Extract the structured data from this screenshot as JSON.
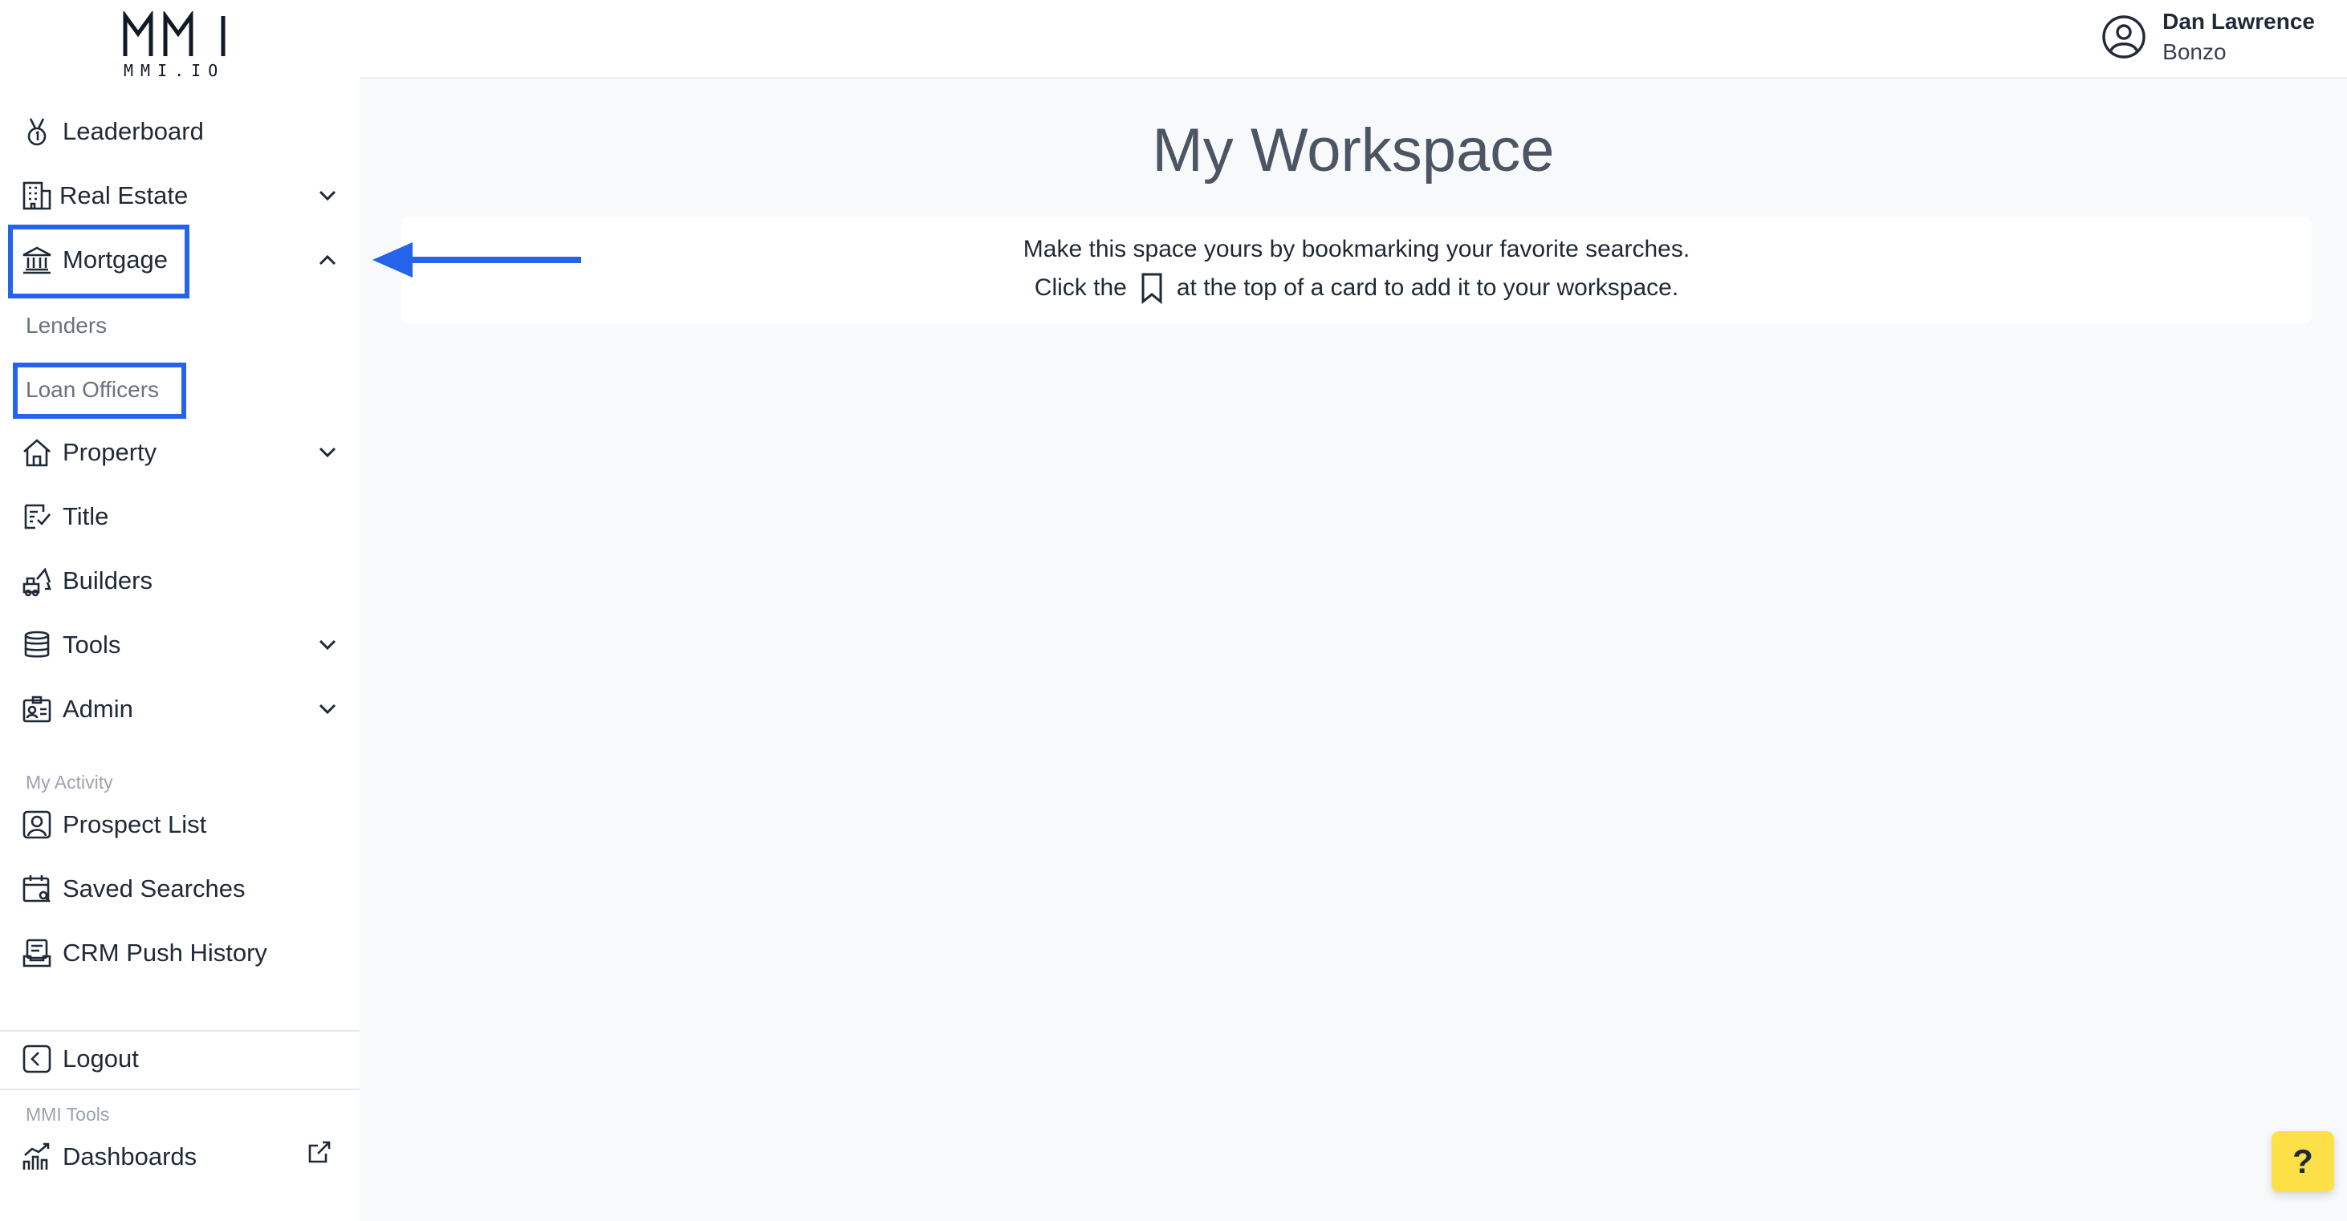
{
  "brand": {
    "logo_text": "MMI.IO"
  },
  "user": {
    "name": "Dan Lawrence",
    "org": "Bonzo"
  },
  "sidebar": {
    "items": [
      {
        "label": "Leaderboard"
      },
      {
        "label": "Real Estate"
      },
      {
        "label": "Mortgage"
      },
      {
        "label": "Property"
      },
      {
        "label": "Title"
      },
      {
        "label": "Builders"
      },
      {
        "label": "Tools"
      },
      {
        "label": "Admin"
      }
    ],
    "mortgage_sub": [
      "Lenders",
      "Loan Officers"
    ],
    "activity_label": "My Activity",
    "activity_items": [
      "Prospect List",
      "Saved Searches",
      "CRM Push History"
    ],
    "logout_label": "Logout",
    "tools_section_label": "MMI Tools",
    "dashboards_label": "Dashboards"
  },
  "main": {
    "title": "My Workspace",
    "card_line1": "Make this space yours by bookmarking your favorite searches.",
    "card_line2_before": "Click the",
    "card_line2_after": "at the top of a card to add it to your workspace."
  },
  "help_label": "?",
  "colors": {
    "highlight": "#2563eb",
    "help_bg": "#fde047"
  },
  "icons": [
    "medal-icon",
    "building-icon",
    "bank-icon",
    "house-icon",
    "title-icon",
    "crane-icon",
    "database-icon",
    "id-card-icon",
    "user-square-icon",
    "calendar-search-icon",
    "inbox-icon",
    "chevron-left-icon",
    "chart-icon",
    "external-link-icon",
    "user-circle-icon",
    "bookmark-icon",
    "chevron-down-icon",
    "chevron-up-icon"
  ]
}
